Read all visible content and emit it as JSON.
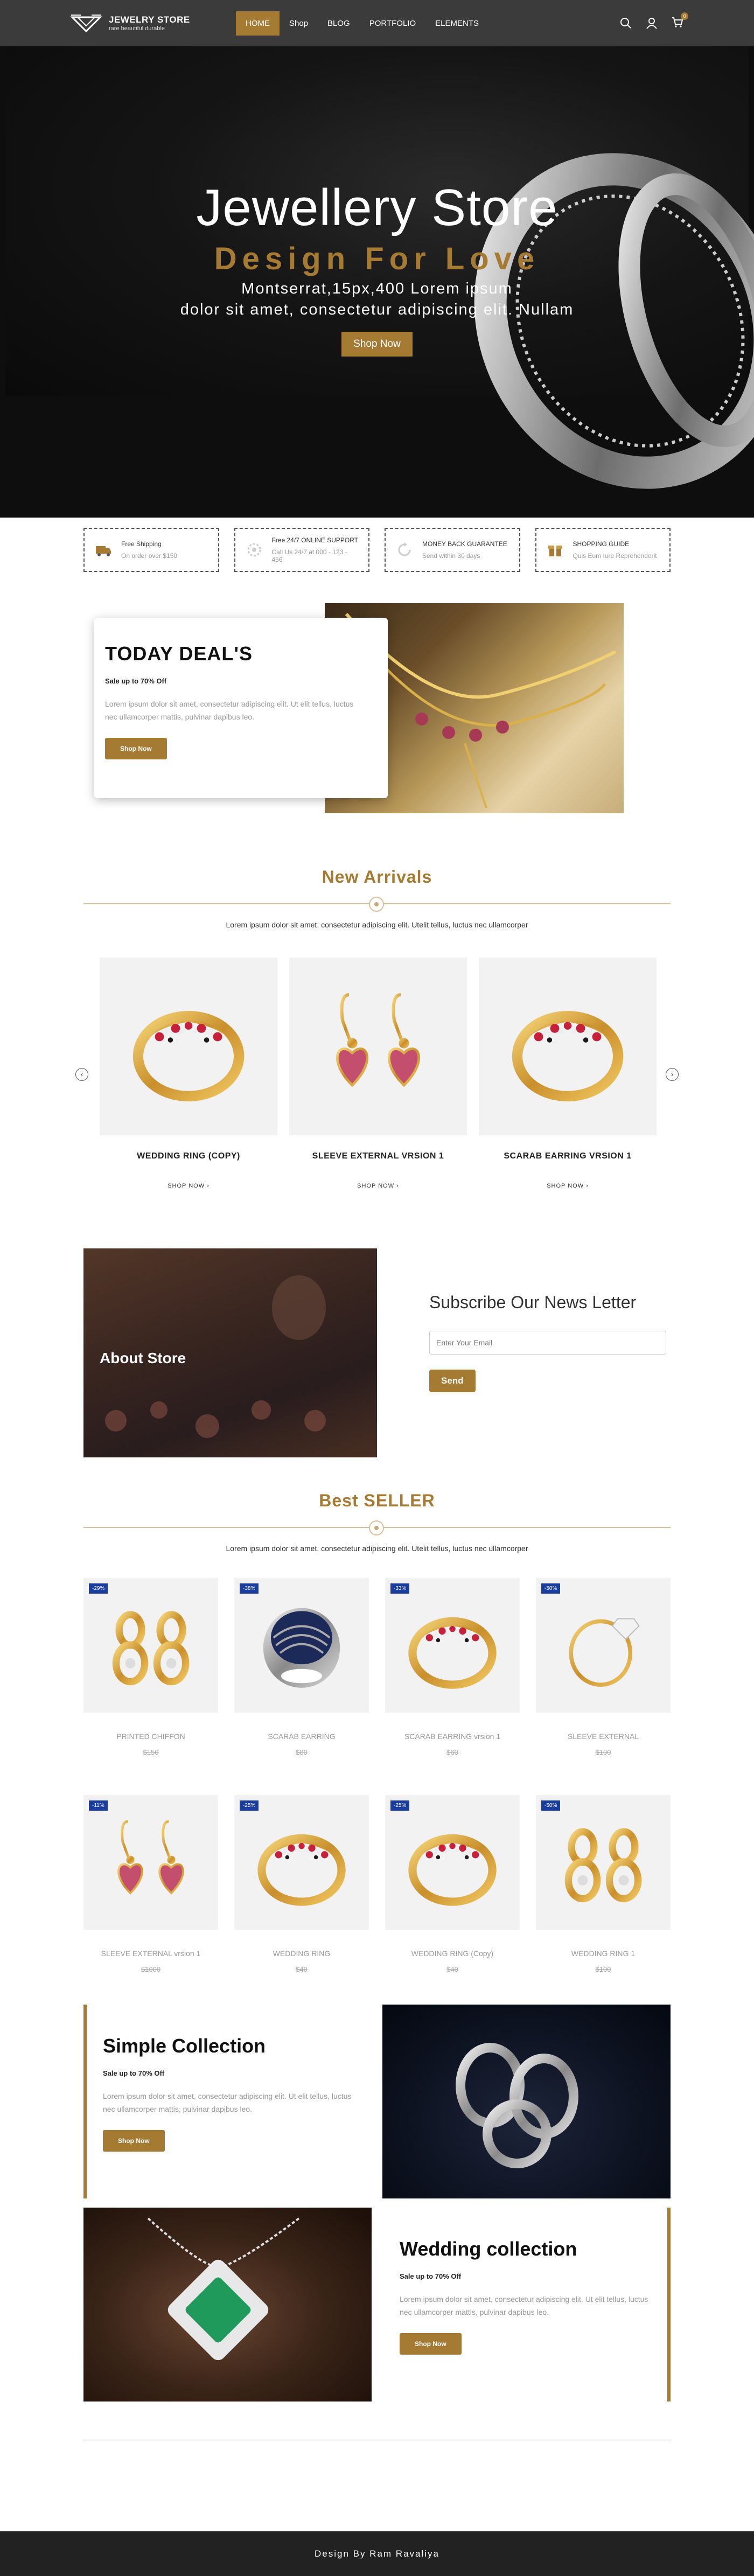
{
  "brand": {
    "title": "JEWELRY STORE",
    "tagline": "rare beautiful durable"
  },
  "nav": {
    "items": [
      "HOME",
      "Shop",
      "BLOG",
      "PORTFOLIO",
      "ELEMENTS"
    ],
    "active": "HOME",
    "cart_count": "0"
  },
  "hero": {
    "title": "Jewellery Store",
    "subtitle": "Design For Love",
    "line1": "Montserrat,15px,400 Lorem ipsum",
    "line2": "dolor sit amet, consectetur adipiscing elit. Nullam",
    "button": "Shop Now"
  },
  "features": [
    {
      "icon": "truck-icon",
      "title": "Free Shipping",
      "text": "On order over $150"
    },
    {
      "icon": "support-icon",
      "title": "Free 24/7 ONLINE SUPPORT",
      "text": "Call Us 24/7 at 000 - 123 - 456"
    },
    {
      "icon": "refresh-icon",
      "title": "MONEY BACK GUARANTEE",
      "text": "Send within 30 days"
    },
    {
      "icon": "gift-icon",
      "title": "SHOPPING GUIDE",
      "text": "Quis Eum Iure Reprehenderit"
    }
  ],
  "deal": {
    "title": "TODAY DEAL'S",
    "small": "Sale up to 70% Off",
    "text": "Lorem ipsum dolor sit amet, consectetur adipiscing elit. Ut elit tellus, luctus nec ullamcorper mattis, pulvinar dapibus leo.",
    "button": "Shop Now"
  },
  "arrivals": {
    "title": "New Arrivals",
    "subtitle": "Lorem ipsum dolor sit amet, consectetur adipiscing elit. Utelit tellus, luctus nec ullamcorper",
    "prev": "‹",
    "next": "›",
    "items": [
      {
        "name": "WEDDING RING (COPY)",
        "shop": "SHOP NOW ›",
        "art": "ring-gem"
      },
      {
        "name": "SLEEVE EXTERNAL VRSION 1",
        "shop": "SHOP NOW ›",
        "art": "earring-heart"
      },
      {
        "name": "SCARAB EARRING VRSION 1",
        "shop": "SHOP NOW ›",
        "art": "ring-gem"
      }
    ]
  },
  "about": {
    "title": "About Store"
  },
  "newsletter": {
    "title": "Subscribe Our News Letter",
    "placeholder": "Enter Your Email",
    "button": "Send"
  },
  "best": {
    "title": "Best SELLER",
    "subtitle": "Lorem ipsum dolor sit amet, consectetur adipiscing elit. Utelit tellus, luctus nec ullamcorper",
    "items": [
      {
        "badge": "-29%",
        "name": "PRINTED CHIFFON",
        "price": "$150",
        "art": "earring-knot"
      },
      {
        "badge": "-38%",
        "name": "SCARAB EARRING",
        "price": "$80",
        "art": "ring-silver"
      },
      {
        "badge": "-33%",
        "name": "SCARAB EARRING vrsion 1",
        "price": "$60",
        "art": "ring-gem"
      },
      {
        "badge": "-50%",
        "name": "SLEEVE EXTERNAL",
        "price": "$100",
        "art": "ring-solitaire"
      },
      {
        "badge": "-11%",
        "name": "SLEEVE EXTERNAL vrsion 1",
        "price": "$1000",
        "art": "earring-heart"
      },
      {
        "badge": "-25%",
        "name": "WEDDING RING",
        "price": "$40",
        "art": "ring-gem"
      },
      {
        "badge": "-25%",
        "name": "WEDDING RING (Copy)",
        "price": "$40",
        "art": "ring-gem"
      },
      {
        "badge": "-50%",
        "name": "WEDDING RING 1",
        "price": "$100",
        "art": "earring-knot"
      }
    ]
  },
  "collections": [
    {
      "title": "Simple Collection",
      "small": "Sale up to 70% Off",
      "text": "Lorem ipsum dolor sit amet, consectetur adipiscing elit. Ut elit tellus, luctus nec ullamcorper mattis, pulvinar dapibus leo.",
      "button": "Shop Now"
    },
    {
      "title": "Wedding collection",
      "small": "Sale up to 70% Off",
      "text": "Lorem ipsum dolor sit amet, consectetur adipiscing elit. Ut elit tellus, luctus nec ullamcorper mattis, pulvinar dapibus leo.",
      "button": "Shop Now"
    }
  ],
  "footer": {
    "text": "Design By Ram Ravaliya"
  },
  "colors": {
    "accent": "#a57a32",
    "nav_bg": "#3b3b3b",
    "badge": "#1a3d9e",
    "footer_bg": "#222222"
  }
}
